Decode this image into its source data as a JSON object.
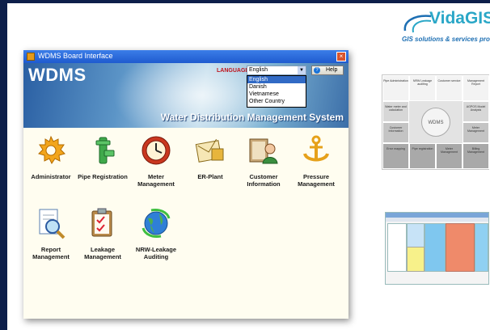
{
  "logo": {
    "name": "VidaGIS",
    "tagline": "GIS solutions & services provid"
  },
  "window": {
    "title": "WDMS Board Interface",
    "close_glyph": "×",
    "app_name": "WDMS",
    "subtitle": "Water Distribution Management System",
    "language_label": "LANGUAGE",
    "language_selected": "English",
    "language_options": [
      "English",
      "Danish",
      "Vietnamese",
      "Other Country"
    ],
    "help_label": "Help",
    "help_glyph": "?",
    "dropdown_arrow": "▼"
  },
  "modules": [
    {
      "label": "Administrator",
      "icon": "gear-icon"
    },
    {
      "label": "Pipe Registration",
      "icon": "pipe-icon"
    },
    {
      "label": "Meter Management",
      "icon": "clock-meter-icon"
    },
    {
      "label": "ER-Plant",
      "icon": "envelope-icon"
    },
    {
      "label": "Customer Information",
      "icon": "customer-book-icon"
    },
    {
      "label": "Pressure Management",
      "icon": "anchor-icon"
    },
    {
      "label": "Report Management",
      "icon": "report-magnifier-icon"
    },
    {
      "label": "Leakage Management",
      "icon": "clipboard-icon"
    },
    {
      "label": "NRW-Leakage Auditing",
      "icon": "globe-arrows-icon"
    }
  ],
  "diagram": {
    "center": "WDMS",
    "top_row": [
      "Pipe Administration",
      "NRW Leakage auditing",
      "Customer service",
      "Management Report"
    ],
    "mid_left": [
      "Water meter and calculation",
      "Customer Information"
    ],
    "mid_right": [
      "AGPOS Model Analysis",
      "Meter Management"
    ],
    "bottom_row": [
      "Error mapping",
      "Pipe registration",
      "Meter Management",
      "Billing Management"
    ]
  },
  "colors": {
    "accent": "#1f5bcf",
    "brand": "#2aa7c7",
    "frame": "#0d1f4a"
  }
}
